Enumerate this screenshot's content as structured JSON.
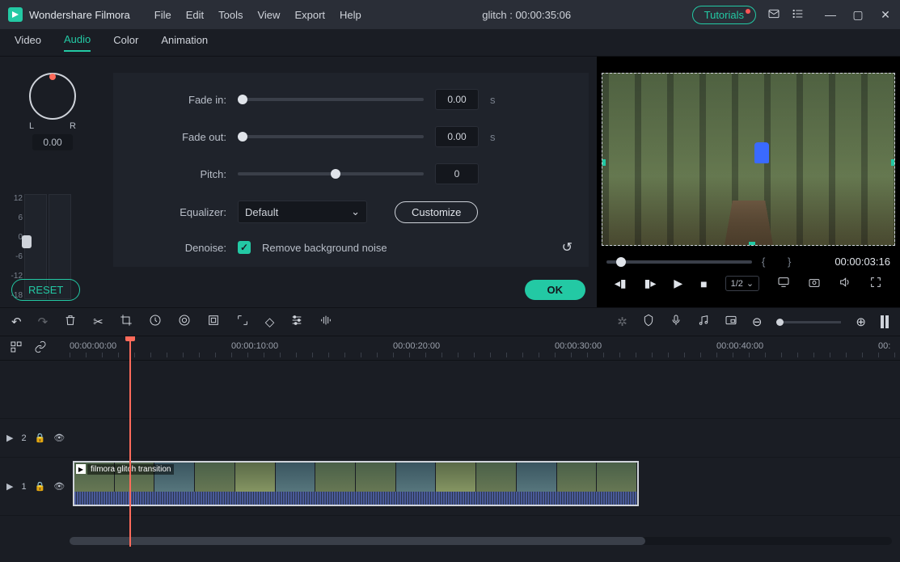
{
  "app": {
    "name": "Wondershare Filmora"
  },
  "menu": [
    "File",
    "Edit",
    "Tools",
    "View",
    "Export",
    "Help"
  ],
  "project": {
    "label": "glitch : 00:00:35:06"
  },
  "title_right": {
    "tutorials": "Tutorials"
  },
  "tabs": [
    "Video",
    "Audio",
    "Color",
    "Animation"
  ],
  "pan": {
    "l": "L",
    "r": "R",
    "value": "0.00"
  },
  "meter_ticks": [
    "12",
    "6",
    "0",
    "-6",
    "-12",
    "-18"
  ],
  "audio": {
    "fade_in": {
      "label": "Fade in:",
      "value": "0.00",
      "unit": "s"
    },
    "fade_out": {
      "label": "Fade out:",
      "value": "0.00",
      "unit": "s"
    },
    "pitch": {
      "label": "Pitch:",
      "value": "0"
    },
    "equalizer": {
      "label": "Equalizer:",
      "value": "Default",
      "customize": "Customize"
    },
    "denoise": {
      "label": "Denoise:",
      "check_label": "Remove background noise"
    }
  },
  "buttons": {
    "reset": "RESET",
    "ok": "OK"
  },
  "preview": {
    "time": "00:00:03:16",
    "speed": "1/2"
  },
  "ruler": [
    "00:00:00:00",
    "00:00:10:00",
    "00:00:20:00",
    "00:00:30:00",
    "00:00:40:00",
    "00:"
  ],
  "tracks": {
    "t2": "2",
    "t1": "1"
  },
  "clip": {
    "label": "filmora glitch transition"
  }
}
